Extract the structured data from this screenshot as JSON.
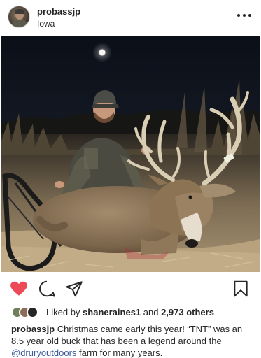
{
  "post": {
    "username": "probassjp",
    "location": "Iowa"
  },
  "icons": {
    "more": "more-options-icon",
    "like": "heart-icon",
    "comment": "comment-icon",
    "share": "send-icon",
    "save": "bookmark-icon"
  },
  "colors": {
    "like_heart": "#ed4956",
    "text": "#262626",
    "mention": "#3d5a9c"
  },
  "likes": {
    "prefix": "Liked by ",
    "user": "shaneraines1",
    "middle": " and ",
    "count": "2,973 others"
  },
  "caption": {
    "username": "probassjp",
    "text_before": "Christmas came early this year! “TNT” was an 8.5 year old buck that has been a legend around the ",
    "mention": "@druryoutdoors",
    "text_after": " farm for many years."
  }
}
